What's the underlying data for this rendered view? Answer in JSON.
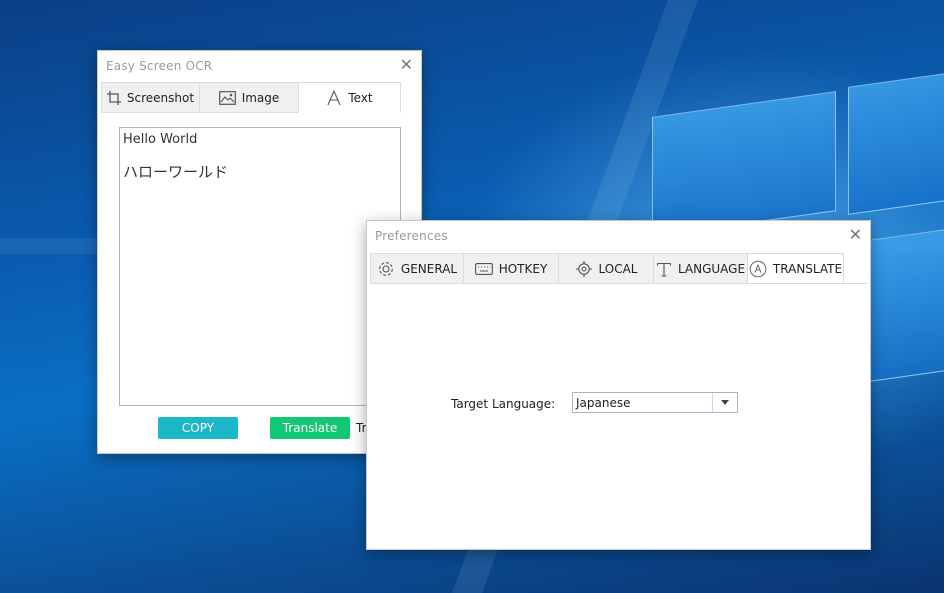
{
  "ocr_window": {
    "title": "Easy Screen OCR",
    "tabs": [
      {
        "label": "Screenshot",
        "icon": "crop-icon"
      },
      {
        "label": "Image",
        "icon": "image-icon"
      },
      {
        "label": "Text",
        "icon": "text-icon"
      }
    ],
    "active_tab": "Text",
    "text_lines": [
      "Hello World",
      "ハローワールド"
    ],
    "copy_label": "COPY",
    "translate_label": "Translate",
    "truncated_label": "Tr"
  },
  "preferences_window": {
    "title": "Preferences",
    "tabs": [
      {
        "label": "GENERAL",
        "icon": "gear-icon"
      },
      {
        "label": "HOTKEY",
        "icon": "keyboard-icon"
      },
      {
        "label": "LOCAL",
        "icon": "location-icon"
      },
      {
        "label": "LANGUAGE",
        "icon": "text-icon"
      },
      {
        "label": "TRANSLATE",
        "icon": "translate-icon"
      }
    ],
    "active_tab": "TRANSLATE",
    "target_language_label": "Target Language:",
    "target_language_value": "Japanese"
  },
  "colors": {
    "copy_button": "#1cb8c8",
    "translate_button": "#12c873"
  }
}
